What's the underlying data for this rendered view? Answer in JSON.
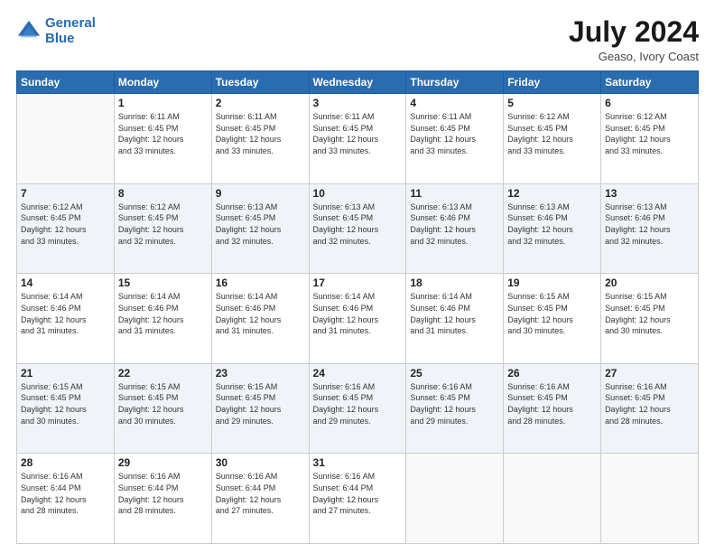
{
  "header": {
    "logo_line1": "General",
    "logo_line2": "Blue",
    "month_year": "July 2024",
    "location": "Geaso, Ivory Coast"
  },
  "weekdays": [
    "Sunday",
    "Monday",
    "Tuesday",
    "Wednesday",
    "Thursday",
    "Friday",
    "Saturday"
  ],
  "weeks": [
    [
      {
        "day": "",
        "empty": true
      },
      {
        "day": "1",
        "sunrise": "6:11 AM",
        "sunset": "6:45 PM",
        "daylight": "12 hours and 33 minutes."
      },
      {
        "day": "2",
        "sunrise": "6:11 AM",
        "sunset": "6:45 PM",
        "daylight": "12 hours and 33 minutes."
      },
      {
        "day": "3",
        "sunrise": "6:11 AM",
        "sunset": "6:45 PM",
        "daylight": "12 hours and 33 minutes."
      },
      {
        "day": "4",
        "sunrise": "6:11 AM",
        "sunset": "6:45 PM",
        "daylight": "12 hours and 33 minutes."
      },
      {
        "day": "5",
        "sunrise": "6:12 AM",
        "sunset": "6:45 PM",
        "daylight": "12 hours and 33 minutes."
      },
      {
        "day": "6",
        "sunrise": "6:12 AM",
        "sunset": "6:45 PM",
        "daylight": "12 hours and 33 minutes."
      }
    ],
    [
      {
        "day": "7",
        "sunrise": "6:12 AM",
        "sunset": "6:45 PM",
        "daylight": "12 hours and 33 minutes."
      },
      {
        "day": "8",
        "sunrise": "6:12 AM",
        "sunset": "6:45 PM",
        "daylight": "12 hours and 32 minutes."
      },
      {
        "day": "9",
        "sunrise": "6:13 AM",
        "sunset": "6:45 PM",
        "daylight": "12 hours and 32 minutes."
      },
      {
        "day": "10",
        "sunrise": "6:13 AM",
        "sunset": "6:45 PM",
        "daylight": "12 hours and 32 minutes."
      },
      {
        "day": "11",
        "sunrise": "6:13 AM",
        "sunset": "6:46 PM",
        "daylight": "12 hours and 32 minutes."
      },
      {
        "day": "12",
        "sunrise": "6:13 AM",
        "sunset": "6:46 PM",
        "daylight": "12 hours and 32 minutes."
      },
      {
        "day": "13",
        "sunrise": "6:13 AM",
        "sunset": "6:46 PM",
        "daylight": "12 hours and 32 minutes."
      }
    ],
    [
      {
        "day": "14",
        "sunrise": "6:14 AM",
        "sunset": "6:46 PM",
        "daylight": "12 hours and 31 minutes."
      },
      {
        "day": "15",
        "sunrise": "6:14 AM",
        "sunset": "6:46 PM",
        "daylight": "12 hours and 31 minutes."
      },
      {
        "day": "16",
        "sunrise": "6:14 AM",
        "sunset": "6:46 PM",
        "daylight": "12 hours and 31 minutes."
      },
      {
        "day": "17",
        "sunrise": "6:14 AM",
        "sunset": "6:46 PM",
        "daylight": "12 hours and 31 minutes."
      },
      {
        "day": "18",
        "sunrise": "6:14 AM",
        "sunset": "6:46 PM",
        "daylight": "12 hours and 31 minutes."
      },
      {
        "day": "19",
        "sunrise": "6:15 AM",
        "sunset": "6:45 PM",
        "daylight": "12 hours and 30 minutes."
      },
      {
        "day": "20",
        "sunrise": "6:15 AM",
        "sunset": "6:45 PM",
        "daylight": "12 hours and 30 minutes."
      }
    ],
    [
      {
        "day": "21",
        "sunrise": "6:15 AM",
        "sunset": "6:45 PM",
        "daylight": "12 hours and 30 minutes."
      },
      {
        "day": "22",
        "sunrise": "6:15 AM",
        "sunset": "6:45 PM",
        "daylight": "12 hours and 30 minutes."
      },
      {
        "day": "23",
        "sunrise": "6:15 AM",
        "sunset": "6:45 PM",
        "daylight": "12 hours and 29 minutes."
      },
      {
        "day": "24",
        "sunrise": "6:16 AM",
        "sunset": "6:45 PM",
        "daylight": "12 hours and 29 minutes."
      },
      {
        "day": "25",
        "sunrise": "6:16 AM",
        "sunset": "6:45 PM",
        "daylight": "12 hours and 29 minutes."
      },
      {
        "day": "26",
        "sunrise": "6:16 AM",
        "sunset": "6:45 PM",
        "daylight": "12 hours and 28 minutes."
      },
      {
        "day": "27",
        "sunrise": "6:16 AM",
        "sunset": "6:45 PM",
        "daylight": "12 hours and 28 minutes."
      }
    ],
    [
      {
        "day": "28",
        "sunrise": "6:16 AM",
        "sunset": "6:44 PM",
        "daylight": "12 hours and 28 minutes."
      },
      {
        "day": "29",
        "sunrise": "6:16 AM",
        "sunset": "6:44 PM",
        "daylight": "12 hours and 28 minutes."
      },
      {
        "day": "30",
        "sunrise": "6:16 AM",
        "sunset": "6:44 PM",
        "daylight": "12 hours and 27 minutes."
      },
      {
        "day": "31",
        "sunrise": "6:16 AM",
        "sunset": "6:44 PM",
        "daylight": "12 hours and 27 minutes."
      },
      {
        "day": "",
        "empty": true
      },
      {
        "day": "",
        "empty": true
      },
      {
        "day": "",
        "empty": true
      }
    ]
  ]
}
